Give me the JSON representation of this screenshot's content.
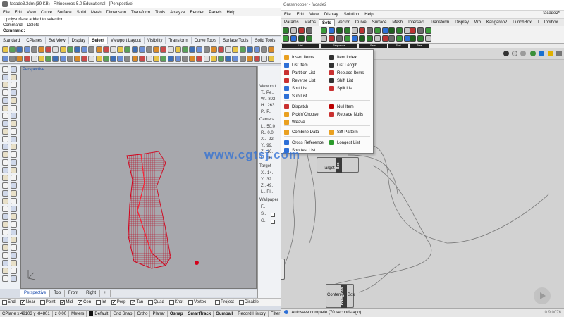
{
  "rhino": {
    "title": "facade3.3dm (39 KB) - Rhinoceros 5.0 Educational - [Perspective]",
    "menu": [
      "File",
      "Edit",
      "View",
      "Curve",
      "Surface",
      "Solid",
      "Mesh",
      "Dimension",
      "Transform",
      "Tools",
      "Analyze",
      "Render",
      "Panels",
      "Help"
    ],
    "command_history": [
      "1 polysurface added to selection",
      "Command: _Delete"
    ],
    "command_prompt": "Command:",
    "toolbar_tabs": [
      "Standard",
      "CPlanes",
      "Set View",
      "Display",
      "Select",
      "Viewport Layout",
      "Visibility",
      "Transform",
      "Curve Tools",
      "Surface Tools",
      "Solid Tools"
    ],
    "active_toolbar_tab": "Select",
    "viewport_label": "Perspective",
    "properties": {
      "viewport_head": "Viewport",
      "viewport_rows": [
        "T.. Pe..",
        "W.. 802",
        "H.. 263",
        "P.. P.."
      ],
      "camera_head": "Camera",
      "camera_rows": [
        "L.. 50.0",
        "R.. 0.0",
        "X.. -22.",
        "Y.. 99.",
        "Z.. 16.",
        "L.. 16."
      ],
      "target_head": "Target",
      "target_rows": [
        "X.. 14.",
        "Y.. 32.",
        "Z.. 49.",
        "L.. Pl.."
      ],
      "wallpaper_head": "Wallpaper",
      "wallpaper_rows": [
        "F..",
        "S..",
        "G.."
      ]
    },
    "viewport_tabs": [
      "Perspective",
      "Top",
      "Front",
      "Right",
      "+"
    ],
    "active_viewport_tab": "Perspective",
    "osnaps": [
      {
        "label": "End",
        "on": false
      },
      {
        "label": "Near",
        "on": true
      },
      {
        "label": "Point",
        "on": false
      },
      {
        "label": "Mid",
        "on": true
      },
      {
        "label": "Cen",
        "on": true
      },
      {
        "label": "Int",
        "on": false
      },
      {
        "label": "Perp",
        "on": true
      },
      {
        "label": "Tan",
        "on": true
      },
      {
        "label": "Quad",
        "on": false
      },
      {
        "label": "Knot",
        "on": false
      },
      {
        "label": "Vertex",
        "on": false
      },
      {
        "label": "Project",
        "on": false
      },
      {
        "label": "Disable",
        "on": false
      }
    ],
    "status": {
      "coords": "CPlane x 49103 y -84801",
      "z": "z 0.00",
      "units": "Meters",
      "layer": "Default",
      "toggles": [
        "Grid Snap",
        "Ortho",
        "Planar",
        "Osnap",
        "SmartTrack",
        "Gumball",
        "Record History",
        "Filter"
      ],
      "bold_toggles": [
        "Osnap",
        "SmartTrack",
        "Gumball"
      ]
    },
    "colors": {
      "geometry": "#d4001a",
      "viewport_bg": "#a7a8ad"
    }
  },
  "grasshopper": {
    "title": "Grasshopper - facade2",
    "doc_name": "facade2*",
    "menu": [
      "File",
      "Edit",
      "View",
      "Display",
      "Solution",
      "Help"
    ],
    "tabs": [
      "Params",
      "Maths",
      "Sets",
      "Vector",
      "Curve",
      "Surface",
      "Mesh",
      "Intersect",
      "Transform",
      "Display",
      "Wb",
      "Kangaroo2",
      "LunchBox",
      "TT Toolbox"
    ],
    "active_tab": "Sets",
    "ribbon_groups": [
      "List",
      "Sequence",
      "Sets",
      "Text",
      "Tree"
    ],
    "dropdown_left": [
      "Insert Items",
      "List Item",
      "Partition List",
      "Reverse List",
      "Sort List",
      "Sub List",
      "Dispatch",
      "Pick'n'Choose",
      "Weave",
      "Combine Data",
      "Cross Reference",
      "Shortest List"
    ],
    "dropdown_right": [
      "Item Index",
      "List Length",
      "Replace Items",
      "Shift List",
      "Split List",
      "Null Item",
      "Replace Nulls",
      "Sift Pattern",
      "Longest List"
    ],
    "components": {
      "bbox_top": {
        "label": "Box",
        "port": "Target"
      },
      "bbox_bottom": {
        "label": "unding Box",
        "port_in": "Content",
        "port_out": "Box"
      }
    },
    "status_text": "Autosave complete (70 seconds ago)",
    "version": "0.9.0076"
  },
  "watermark": "www.cgtsj.com"
}
